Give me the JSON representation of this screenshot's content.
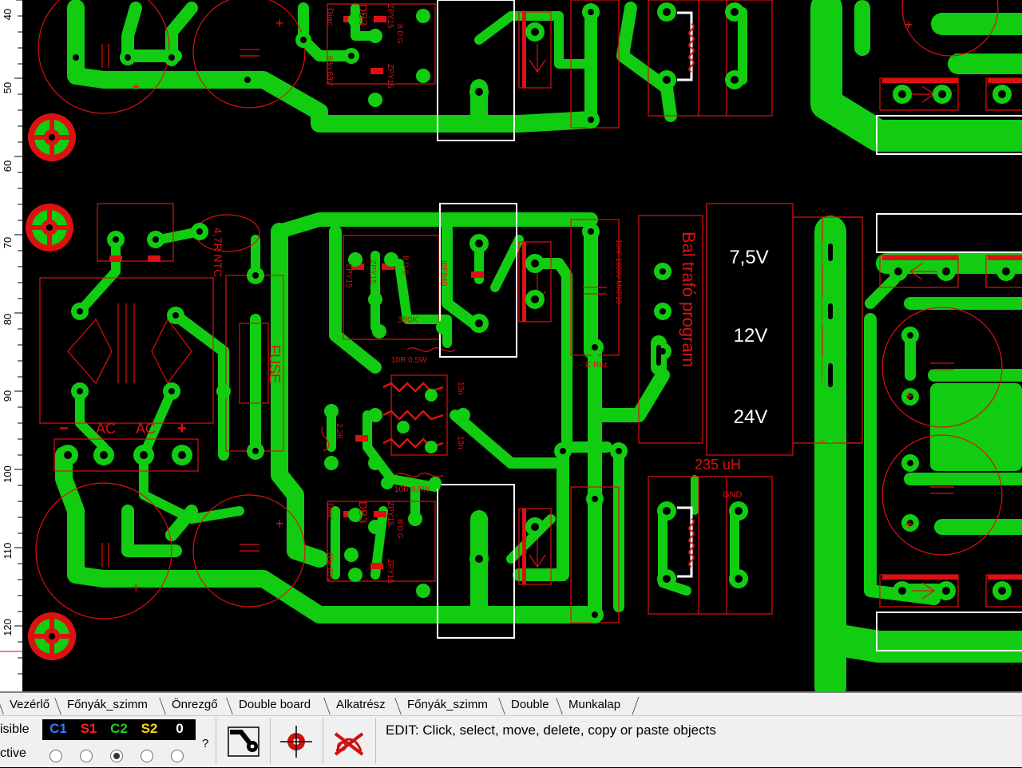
{
  "ruler": {
    "marks": [
      "40",
      "50",
      "60",
      "70",
      "80",
      "90",
      "100",
      "110",
      "120"
    ]
  },
  "colors": {
    "copper": "#11cc11",
    "silk": "#dd1111",
    "outline": "#ffffff",
    "background": "#000000"
  },
  "board": {
    "labels": {
      "v75": "7,5V",
      "v12": "12V",
      "v24": "24V",
      "inductor": "235 uH",
      "fuse": "FUSE",
      "ntc": "4,7R NTC",
      "ac": "AC",
      "plus": "+",
      "minus": "−",
      "diac": "Diac",
      "db3": "DB3",
      "cap68": "68n 63V",
      "zpy15": "ZPY15",
      "bdg": "B D G",
      "r390": "390K",
      "r10r": "10R 0,5W",
      "c13n": "13n",
      "c22": "2,2K",
      "ibf": "IBF840",
      "mkp": "10nF 1600V MKP10",
      "crez": "C Rez",
      "trafo": "Bal trafó program",
      "gnd": "GND"
    }
  },
  "sheet_tabs": [
    "Vezérlő",
    "Főnyák_szimm",
    "Önrezgő",
    "Double board",
    "Alkatrész",
    "Főnyák_szimm",
    "Double",
    "Munkalap"
  ],
  "toolbar": {
    "visible_label": "isible",
    "active_label": "ctive",
    "layers": [
      {
        "key": "C1",
        "color": "#3a78ff"
      },
      {
        "key": "S1",
        "color": "#ff2020"
      },
      {
        "key": "C2",
        "color": "#22cc22"
      },
      {
        "key": "S2",
        "color": "#ffd700"
      },
      {
        "key": "0",
        "color": "#ffffff"
      }
    ],
    "active_layer": "C2",
    "help": "?",
    "tools": [
      {
        "name": "trace-tool"
      },
      {
        "name": "pad-tool"
      },
      {
        "name": "no-route-tool"
      }
    ],
    "status": "EDIT:  Click, select, move, delete, copy or paste objects"
  }
}
